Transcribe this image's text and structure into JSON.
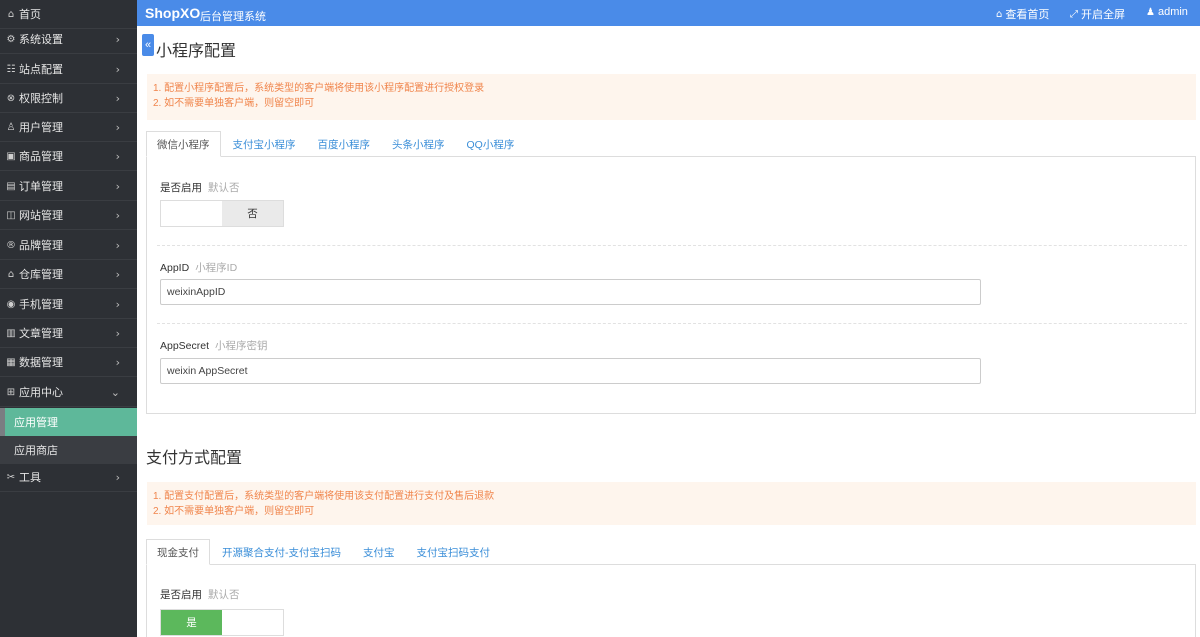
{
  "sidebar": {
    "items": [
      {
        "icon": "⌂",
        "label": "首页",
        "arrow": ""
      },
      {
        "icon": "⚙",
        "label": "系统设置",
        "arrow": "›"
      },
      {
        "icon": "☷",
        "label": "站点配置",
        "arrow": "›"
      },
      {
        "icon": "⊗",
        "label": "权限控制",
        "arrow": "›"
      },
      {
        "icon": "♙",
        "label": "用户管理",
        "arrow": "›"
      },
      {
        "icon": "▣",
        "label": "商品管理",
        "arrow": "›"
      },
      {
        "icon": "▤",
        "label": "订单管理",
        "arrow": "›"
      },
      {
        "icon": "◫",
        "label": "网站管理",
        "arrow": "›"
      },
      {
        "icon": "®",
        "label": "品牌管理",
        "arrow": "›"
      },
      {
        "icon": "⌂",
        "label": "仓库管理",
        "arrow": "›"
      },
      {
        "icon": "◉",
        "label": "手机管理",
        "arrow": "›"
      },
      {
        "icon": "▥",
        "label": "文章管理",
        "arrow": "›"
      },
      {
        "icon": "▦",
        "label": "数据管理",
        "arrow": "›"
      },
      {
        "icon": "⊞",
        "label": "应用中心",
        "arrow": "⌄"
      }
    ],
    "subitems": [
      {
        "label": "应用管理"
      },
      {
        "label": "应用商店"
      }
    ],
    "tools": {
      "icon": "✂",
      "label": "工具",
      "arrow": "›"
    }
  },
  "header": {
    "brand": "ShopXO",
    "subtitle": "后台管理系统",
    "nav": [
      {
        "icon": "⌂",
        "label": "查看首页"
      },
      {
        "icon": "⤢",
        "label": "开启全屏"
      },
      {
        "icon": "♟",
        "label": "admin"
      }
    ]
  },
  "main": {
    "collapse_icon": "«",
    "miniprogram": {
      "title": "小程序配置",
      "tips": [
        "1. 配置小程序配置后，系统类型的客户端将使用该小程序配置进行授权登录",
        "2. 如不需要单独客户端，则留空即可"
      ],
      "tabs": [
        "微信小程序",
        "支付宝小程序",
        "百度小程序",
        "头条小程序",
        "QQ小程序"
      ],
      "enable_label": "是否启用",
      "enable_hint": "默认否",
      "toggle_off": "否",
      "appid_label": "AppID",
      "appid_hint": "小程序ID",
      "appid_value": "weixinAppID",
      "appsecret_label": "AppSecret",
      "appsecret_hint": "小程序密钥",
      "appsecret_value": "weixin AppSecret"
    },
    "payment": {
      "title": "支付方式配置",
      "tips": [
        "1. 配置支付配置后，系统类型的客户端将使用该支付配置进行支付及售后退款",
        "2. 如不需要单独客户端，则留空即可"
      ],
      "tabs": [
        "现金支付",
        "开源聚合支付-支付宝扫码",
        "支付宝",
        "支付宝扫码支付"
      ],
      "enable_label": "是否启用",
      "enable_hint": "默认否",
      "toggle_on": "是"
    }
  }
}
